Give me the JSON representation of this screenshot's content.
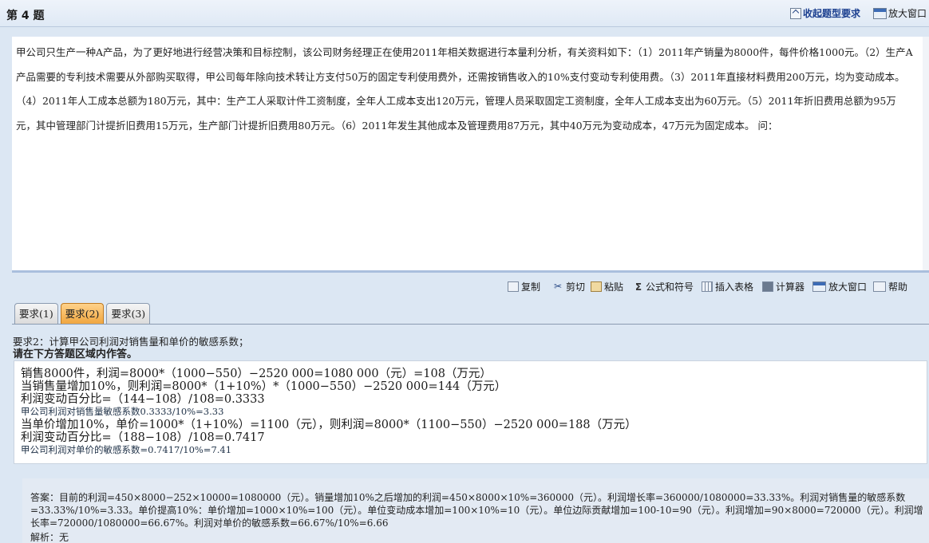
{
  "header": {
    "title": "第 4 题",
    "collapse_label": "收起题型要求",
    "enlarge_label": "放大窗口"
  },
  "question": {
    "text": "甲公司只生产一种A产品，为了更好地进行经营决策和目标控制，该公司财务经理正在使用2011年相关数据进行本量利分析，有关资料如下：（1）2011年产销量为8000件，每件价格1000元。（2）生产A产品需要的专利技术需要从外部购买取得，甲公司每年除向技术转让方支付50万的固定专利使用费外，还需按销售收入的10%支付变动专利使用费。（3）2011年直接材料费用200万元，均为变动成本。（4）2011年人工成本总额为180万元，其中：生产工人采取计件工资制度，全年人工成本支出120万元，管理人员采取固定工资制度，全年人工成本支出为60万元。（5）2011年折旧费用总额为95万元，其中管理部门计提折旧费用15万元，生产部门计提折旧费用80万元。（6）2011年发生其他成本及管理费用87万元，其中40万元为变动成本，47万元为固定成本。 问："
  },
  "toolbar": {
    "copy": "复制",
    "cut": "剪切",
    "paste": "粘贴",
    "formula": "公式和符号",
    "table": "插入表格",
    "calculator": "计算器",
    "enlarge": "放大窗口",
    "help": "帮助"
  },
  "tabs": [
    "要求(1)",
    "要求(2)",
    "要求(3)"
  ],
  "active_tab": 1,
  "requirement": {
    "text": "要求2：计算甲公司利润对销售量和单价的敏感系数；",
    "note": "请在下方答题区域内作答。"
  },
  "answer_input": {
    "lines": [
      "销售8000件，利润=8000*（1000−550）−2520 000=1080 000（元）=108（万元）",
      "当销售量增加10%，则利润=8000*（1+10%）*（1000−550）−2520 000=144（万元）",
      "利润变动百分比=（144−108）/108=0.3333",
      "甲公司利润对销售量敏感系数0.3333/10%=3.33",
      "当单价增加10%，单价=1000*（1+10%）=1100（元），则利润=8000*（1100−550）−2520 000=188（万元）",
      "利润变动百分比=（188−108）/108=0.7417",
      "甲公司利润对单价的敏感系数=0.7417/10%=7.41"
    ]
  },
  "reference": {
    "answer": "答案：目前的利润=450×8000−252×10000=1080000（元）。销量增加10%之后增加的利润=450×8000×10%=360000（元）。利润增长率=360000/1080000=33.33%。利润对销售量的敏感系数=33.33%/10%=3.33。单价提高10%：单价增加=1000×10%=100（元）。单位变动成本增加=100×10%=10（元）。单位边际贡献增加=100-10=90（元）。利润增加=90×8000=720000（元）。利润增长率=720000/1080000=66.67%。利润对单价的敏感系数=66.67%/10%=6.66",
    "analysis": "解析：无"
  }
}
